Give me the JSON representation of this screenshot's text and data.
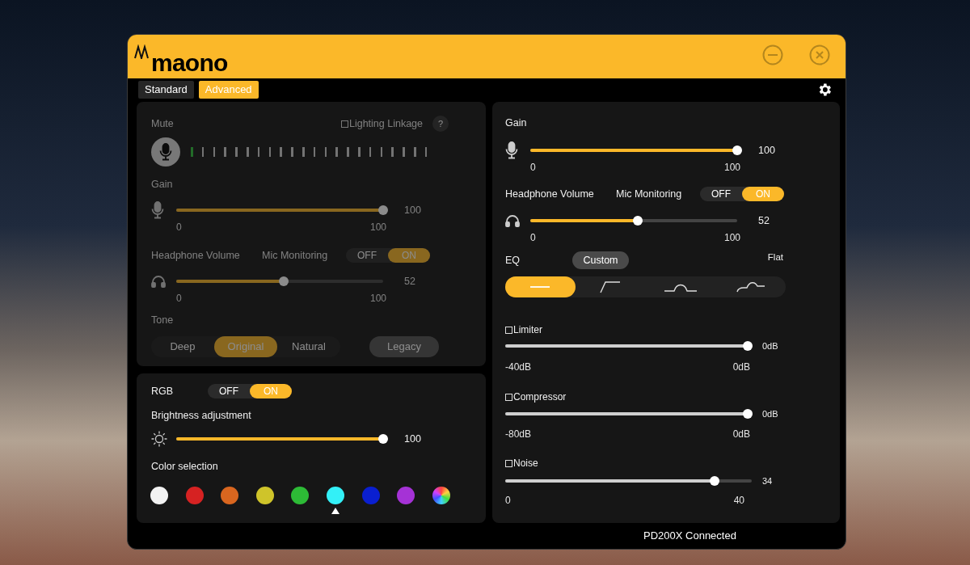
{
  "window": {
    "logo": "maono"
  },
  "tabs": [
    {
      "label": "Standard",
      "selected": false
    },
    {
      "label": "Advanced",
      "selected": true
    }
  ],
  "basic_panel": {
    "disabled": true,
    "mute_label": "Mute",
    "lighting_linkage": {
      "label": "Lighting Linkage",
      "checked": false
    },
    "help": "?",
    "meter": {
      "level": 0.04
    },
    "gain": {
      "label": "Gain",
      "level": 1,
      "reading": "100",
      "min": "0",
      "max": "100"
    },
    "headphone": {
      "label": "Headphone Volume",
      "level": 0.52,
      "reading": "52",
      "min": "0",
      "max": "100"
    },
    "mic_monitoring": {
      "label": "Mic Monitoring",
      "options": [
        {
          "label": "OFF",
          "selected": false
        },
        {
          "label": "ON",
          "selected": true
        }
      ]
    },
    "tone": {
      "label": "Tone",
      "options": [
        {
          "label": "Deep",
          "selected": false
        },
        {
          "label": "Original",
          "selected": true
        },
        {
          "label": "Natural",
          "selected": false
        }
      ],
      "legacy_button": "Legacy"
    }
  },
  "rgb_panel": {
    "label": "RGB",
    "options": [
      {
        "label": "OFF",
        "selected": false
      },
      {
        "label": "ON",
        "selected": true
      }
    ],
    "brightness": {
      "label": "Brightness adjustment",
      "level": 1,
      "reading": "100"
    },
    "color_label": "Color selection",
    "colors": [
      {
        "kind": "solid",
        "color": "#f2f2f2",
        "selected": false
      },
      {
        "kind": "solid",
        "color": "#d62222",
        "selected": false
      },
      {
        "kind": "solid",
        "color": "#d9661f",
        "selected": false
      },
      {
        "kind": "solid",
        "color": "#cfc42a",
        "selected": false
      },
      {
        "kind": "solid",
        "color": "#2dbb36",
        "selected": false
      },
      {
        "kind": "solid",
        "color": "#33f0f7",
        "selected": true
      },
      {
        "kind": "solid",
        "color": "#0a1fd0",
        "selected": false
      },
      {
        "kind": "solid",
        "color": "#a532d6",
        "selected": false
      },
      {
        "kind": "spectrum",
        "selected": false
      }
    ]
  },
  "advanced_panel": {
    "gain": {
      "label": "Gain",
      "level": 1,
      "reading": "100",
      "min": "0",
      "max": "100"
    },
    "headphone": {
      "label": "Headphone Volume",
      "level": 0.52,
      "reading": "52",
      "min": "0",
      "max": "100"
    },
    "mic_monitoring": {
      "label": "Mic Monitoring",
      "options": [
        {
          "label": "OFF",
          "selected": false
        },
        {
          "label": "ON",
          "selected": true
        }
      ]
    },
    "eq": {
      "label": "EQ",
      "preset": "Custom",
      "preset_name": "Flat",
      "curves": [
        {
          "kind": "flat",
          "selected": true
        },
        {
          "kind": "low-cut",
          "selected": false
        },
        {
          "kind": "mid-boost",
          "selected": false
        },
        {
          "kind": "presence",
          "selected": false
        }
      ]
    },
    "processors": [
      {
        "label": "Limiter",
        "checked": false,
        "level": 1,
        "reading": "0dB",
        "min": "-40dB",
        "max": "0dB"
      },
      {
        "label": "Compressor",
        "checked": false,
        "level": 1,
        "reading": "0dB",
        "min": "-80dB",
        "max": "0dB"
      },
      {
        "label": "Noise",
        "checked": false,
        "level": 0.85,
        "reading": "34",
        "min": "0",
        "max": "40"
      }
    ]
  },
  "status_bar": "PD200X Connected"
}
